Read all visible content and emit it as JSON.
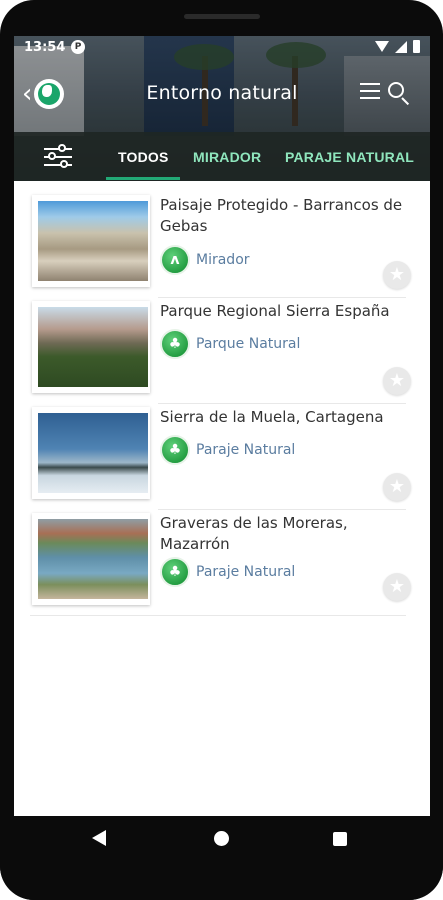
{
  "status": {
    "time": "13:54",
    "app_badge": "P"
  },
  "appbar": {
    "title": "Entorno natural",
    "back_label": "‹"
  },
  "tabs": [
    {
      "label": "TODOS",
      "selected": true
    },
    {
      "label": "MIRADOR",
      "selected": false
    },
    {
      "label": "PARAJE NATURAL",
      "selected": false
    }
  ],
  "items": [
    {
      "title": "Paisaje Protegido - Barrancos de Gebas",
      "category": "Mirador",
      "category_icon": "mirador-icon",
      "favorite": false
    },
    {
      "title": "Parque Regional Sierra España",
      "category": "Parque Natural",
      "category_icon": "parque-natural-icon",
      "favorite": false
    },
    {
      "title": "Sierra de la Muela, Cartagena",
      "category": "Paraje Natural",
      "category_icon": "paraje-natural-icon",
      "favorite": false
    },
    {
      "title": "Graveras de las Moreras, Mazarrón",
      "category": "Paraje Natural",
      "category_icon": "paraje-natural-icon",
      "favorite": false
    }
  ],
  "colors": {
    "accent": "#22a976",
    "tab_inactive": "#8fe6bd",
    "category_text": "#5b7da0"
  }
}
